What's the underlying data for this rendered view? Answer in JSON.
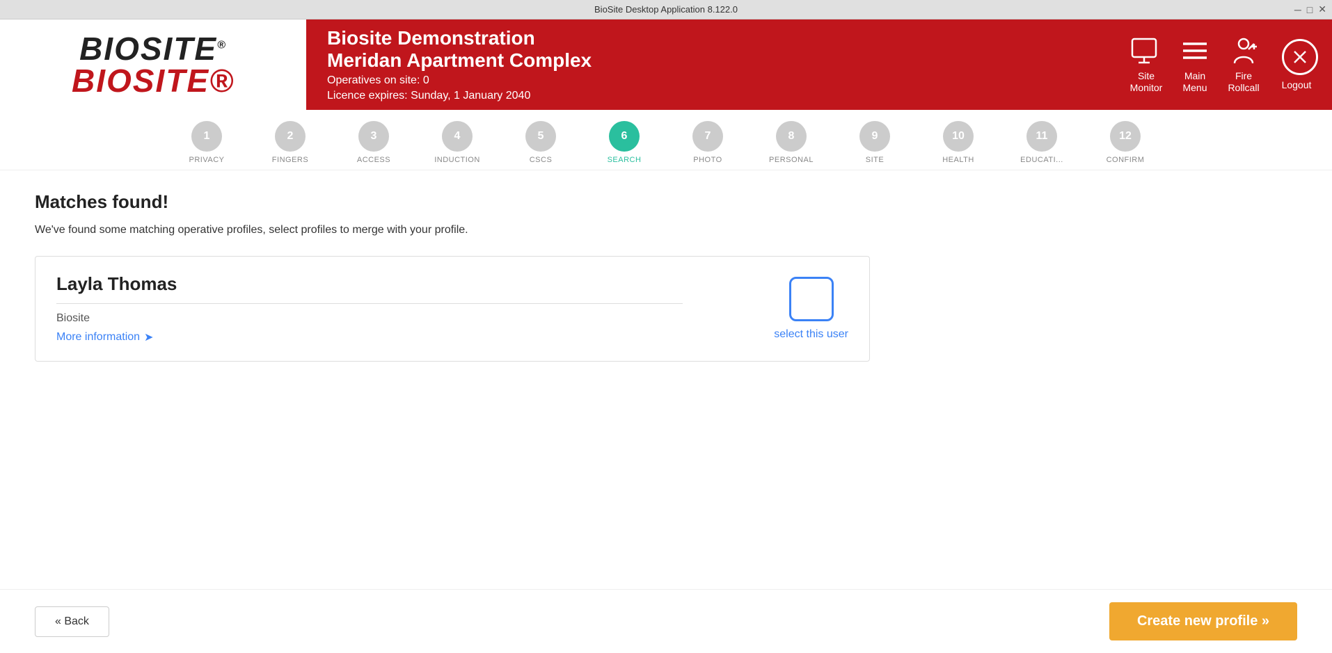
{
  "titleBar": {
    "title": "BioSite Desktop Application 8.122.0"
  },
  "header": {
    "logo": {
      "line1": "BIOSITE",
      "line2": "BIOSITE",
      "reg": "®"
    },
    "company": "Biosite Demonstration",
    "site": "Meridan Apartment Complex",
    "operatives": "Operatives on site: 0",
    "licence": "Licence expires: Sunday, 1 January 2040",
    "actions": {
      "siteMonitor": {
        "label": "Site\nMonitor"
      },
      "mainMenu": {
        "label": "Main\nMenu"
      },
      "fireRollcall": {
        "label": "Fire\nRollcall"
      },
      "logout": {
        "label": "Logout"
      }
    }
  },
  "steps": [
    {
      "number": "1",
      "label": "PRIVACY",
      "active": false
    },
    {
      "number": "2",
      "label": "FINGERS",
      "active": false
    },
    {
      "number": "3",
      "label": "ACCESS",
      "active": false
    },
    {
      "number": "4",
      "label": "INDUCTION",
      "active": false
    },
    {
      "number": "5",
      "label": "CSCS",
      "active": false
    },
    {
      "number": "6",
      "label": "SEARCH",
      "active": true
    },
    {
      "number": "7",
      "label": "PHOTO",
      "active": false
    },
    {
      "number": "8",
      "label": "PERSONAL",
      "active": false
    },
    {
      "number": "9",
      "label": "SITE",
      "active": false
    },
    {
      "number": "10",
      "label": "HEALTH",
      "active": false
    },
    {
      "number": "11",
      "label": "EDUCATI...",
      "active": false
    },
    {
      "number": "12",
      "label": "CONFIRM",
      "active": false
    }
  ],
  "page": {
    "title": "Matches found!",
    "description": "We've found some matching operative profiles, select profiles to merge with your profile.",
    "profile": {
      "name": "Layla Thomas",
      "organisation": "Biosite",
      "moreInfoLabel": "More information",
      "selectLabel": "select this user"
    }
  },
  "footer": {
    "backLabel": "« Back",
    "createLabel": "Create new profile »"
  }
}
